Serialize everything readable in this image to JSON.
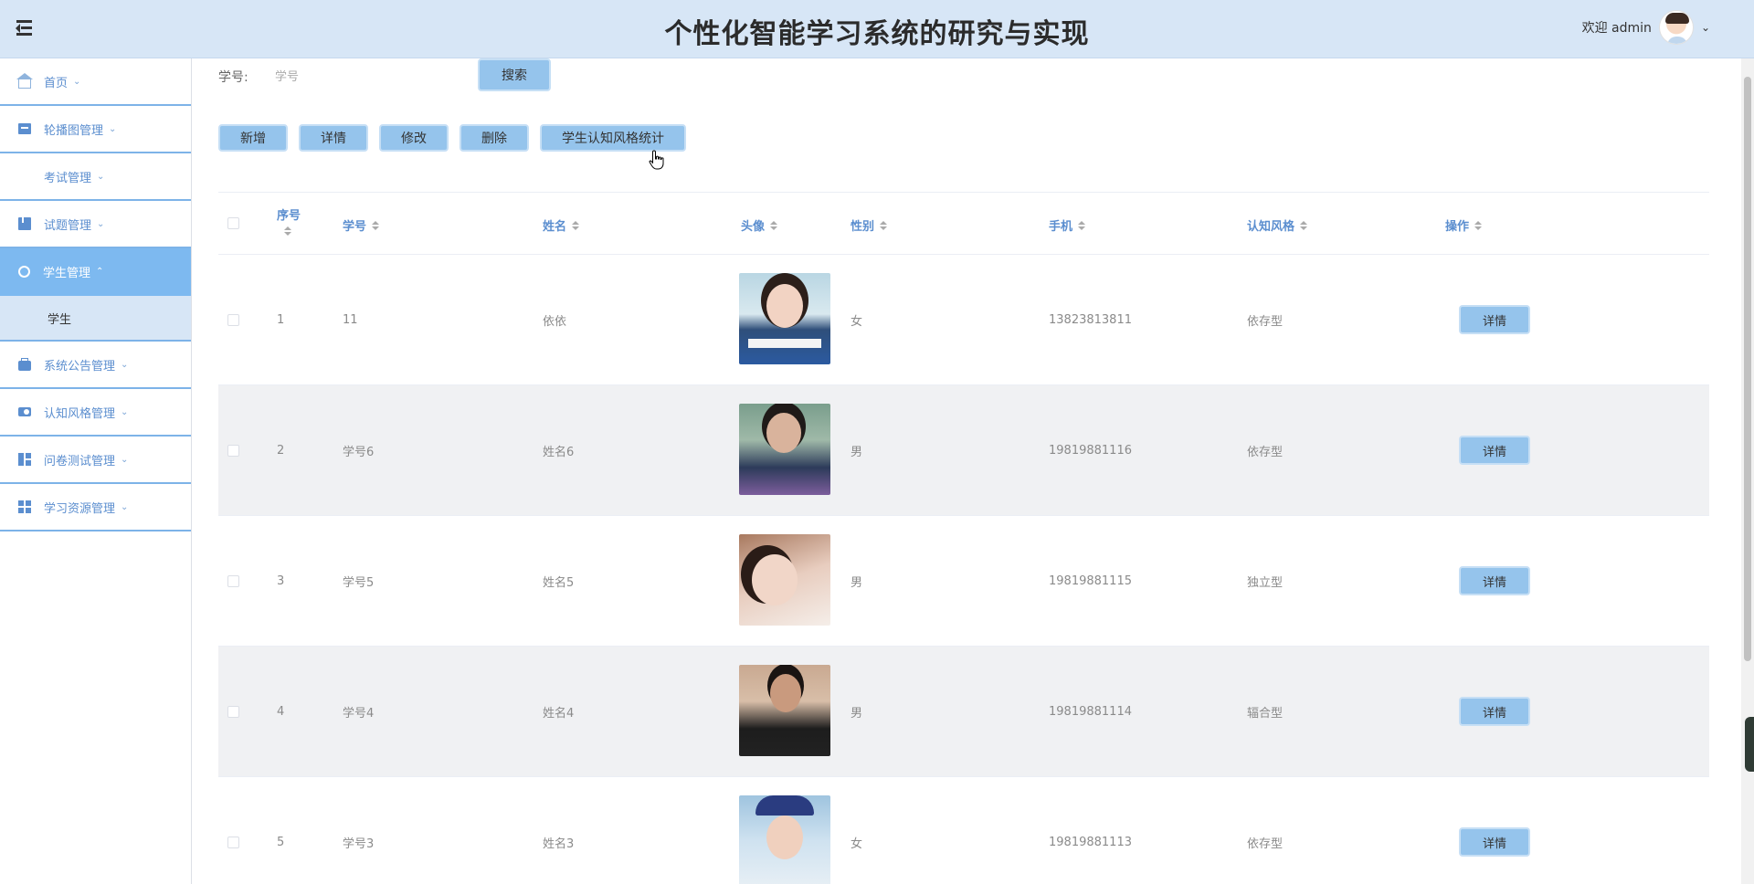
{
  "header": {
    "title": "个性化智能学习系统的研究与实现",
    "welcome": "欢迎 admin"
  },
  "sidebar": {
    "items": [
      {
        "label": "首页"
      },
      {
        "label": "轮播图管理"
      },
      {
        "label": "考试管理"
      },
      {
        "label": "试题管理"
      },
      {
        "label": "学生管理"
      },
      {
        "label": "系统公告管理"
      },
      {
        "label": "认知风格管理"
      },
      {
        "label": "问卷测试管理"
      },
      {
        "label": "学习资源管理"
      }
    ],
    "active_sub": "学生"
  },
  "search": {
    "label": "学号:",
    "placeholder": "学号",
    "button": "搜索"
  },
  "toolbar": {
    "add": "新增",
    "detail": "详情",
    "edit": "修改",
    "delete": "删除",
    "stats": "学生认知风格统计"
  },
  "table": {
    "columns": [
      "序号",
      "学号",
      "姓名",
      "头像",
      "性别",
      "手机",
      "认知风格",
      "操作"
    ],
    "rows": [
      {
        "index": "1",
        "student_id": "11",
        "name": "依依",
        "gender": "女",
        "phone": "13823813811",
        "style": "依存型",
        "action": "详情"
      },
      {
        "index": "2",
        "student_id": "学号6",
        "name": "姓名6",
        "gender": "男",
        "phone": "19819881116",
        "style": "依存型",
        "action": "详情"
      },
      {
        "index": "3",
        "student_id": "学号5",
        "name": "姓名5",
        "gender": "男",
        "phone": "19819881115",
        "style": "独立型",
        "action": "详情"
      },
      {
        "index": "4",
        "student_id": "学号4",
        "name": "姓名4",
        "gender": "男",
        "phone": "19819881114",
        "style": "辐合型",
        "action": "详情"
      },
      {
        "index": "5",
        "student_id": "学号3",
        "name": "姓名3",
        "gender": "女",
        "phone": "19819881113",
        "style": "依存型",
        "action": "详情"
      }
    ]
  },
  "colors": {
    "header_bg": "#d7e6f6",
    "accent": "#7db9f0",
    "button": "#95c4ec",
    "link_blue": "#5b8ecf"
  }
}
